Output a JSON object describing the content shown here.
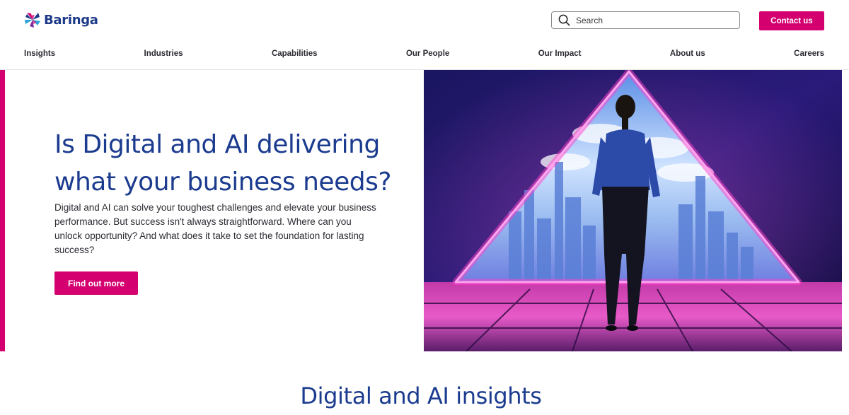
{
  "brand": {
    "name": "Baringa",
    "primary_color": "#d4006f",
    "heading_color": "#1b3b8f"
  },
  "header": {
    "search": {
      "placeholder": "Search",
      "icon": "search-icon"
    },
    "contact_label": "Contact us"
  },
  "nav": {
    "items": [
      {
        "label": "Insights"
      },
      {
        "label": "Industries"
      },
      {
        "label": "Capabilities"
      },
      {
        "label": "Our People"
      },
      {
        "label": "Our Impact"
      },
      {
        "label": "About us"
      },
      {
        "label": "Careers"
      }
    ]
  },
  "hero": {
    "title": "Is Digital and AI delivering what your business needs?",
    "description": "Digital and AI can solve your toughest challenges and elevate your business performance. But success isn't always straightforward. Where can you unlock opportunity? And what does it take to set the foundation for lasting success?",
    "cta_label": "Find out more"
  },
  "section": {
    "title": "Digital and AI insights"
  }
}
